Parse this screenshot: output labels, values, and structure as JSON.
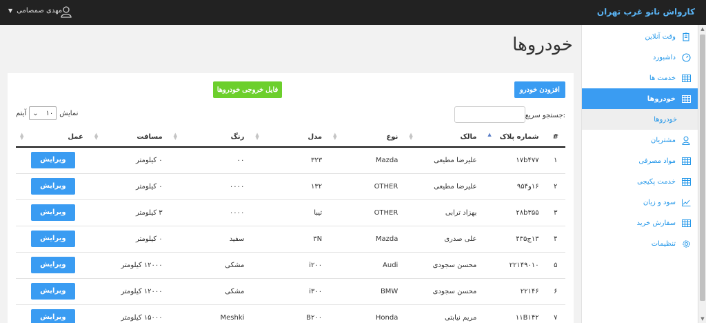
{
  "topbar": {
    "brand": "کارواش نانو غرب تهران",
    "user_name": "مهدی صمصامی"
  },
  "sidebar": {
    "items": [
      {
        "label": "وقت آنلاین",
        "icon": "clipboard-icon"
      },
      {
        "label": "داشبورد",
        "icon": "dashboard-icon"
      },
      {
        "label": "خدمت ها",
        "icon": "table-icon"
      },
      {
        "label": "خودروها",
        "icon": "table-icon"
      },
      {
        "label": "مشتریان",
        "icon": "user-icon"
      },
      {
        "label": "مواد مصرفی",
        "icon": "table-icon"
      },
      {
        "label": "خدمت پکیجی",
        "icon": "table-icon"
      },
      {
        "label": "سود و زیان",
        "icon": "chart-icon"
      },
      {
        "label": "سفارش خرید",
        "icon": "table-icon"
      },
      {
        "label": "تنظیمات",
        "icon": "gear-icon"
      }
    ],
    "sub_item": "خودروها"
  },
  "page": {
    "title": "خودروها",
    "add_button": "افزودن خودرو",
    "export_button": "فایل خروجی خودروها",
    "search_label": "جستجو سریع:",
    "length_prefix": "نمایش",
    "length_value": "۱۰",
    "length_suffix": "آیتم"
  },
  "table": {
    "columns": [
      "#",
      "شماره پلاک",
      "مالک",
      "نوع",
      "مدل",
      "رنگ",
      "مسافت",
      "عمل"
    ],
    "edit_label": "ویرایش",
    "rows": [
      {
        "num": "۱",
        "plate": "۱۷b۴۷۷",
        "owner": "علیرضا مطیعی",
        "type": "Mazda",
        "model": "۳۲۳",
        "color": "۰۰",
        "distance": "۰ کیلومتر"
      },
      {
        "num": "۲",
        "plate": "۱۶و۹۵۴",
        "owner": "علیرضا مطیعی",
        "type": "OTHER",
        "model": "۱۳۲",
        "color": "۰۰۰۰",
        "distance": "۰ کیلومتر"
      },
      {
        "num": "۳",
        "plate": "۲۸b۳۵۵",
        "owner": "بهزاد ترابی",
        "type": "OTHER",
        "model": "تیبا",
        "color": "۰۰۰۰",
        "distance": "۳ کیلومتر"
      },
      {
        "num": "۴",
        "plate": "۱۳ج۴۳۵",
        "owner": "علی صدری",
        "type": "Mazda",
        "model": "۳N",
        "color": "سفید",
        "distance": "۰ کیلومتر"
      },
      {
        "num": "۵",
        "plate": "۲۲۱۴۹۰۱۰",
        "owner": "محسن سجودی",
        "type": "Audi",
        "model": "i۲۰۰",
        "color": "مشکی",
        "distance": "۱۲۰۰۰ کیلومتر"
      },
      {
        "num": "۶",
        "plate": "۲۲۱۴۶",
        "owner": "محسن سجودی",
        "type": "BMW",
        "model": "i۳۰۰",
        "color": "مشکی",
        "distance": "۱۲۰۰۰ کیلومتر"
      },
      {
        "num": "۷",
        "plate": "۱۱B۱۴۲",
        "owner": "مریم نیابتی",
        "type": "Honda",
        "model": "B۲۰۰",
        "color": "Meshki",
        "distance": "۱۵۰۰۰ کیلومتر"
      }
    ]
  }
}
